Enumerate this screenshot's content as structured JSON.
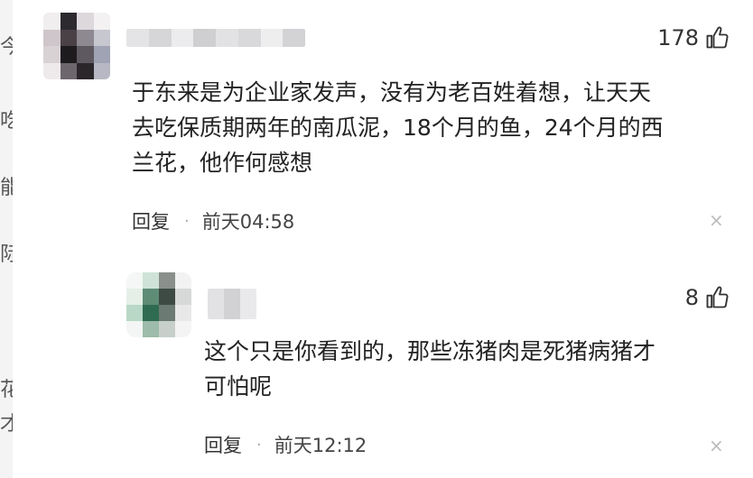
{
  "comment": {
    "likes": "178",
    "text_lines": [
      "于东来是为企业家发声，没有为老百姓着想，让天天",
      "去吃保质期两年的南瓜泥，18个月的鱼，24个月的西",
      "兰花，他作何感想"
    ],
    "reply_label": "回复",
    "separator": "·",
    "time": "前天04:58",
    "close_glyph": "×"
  },
  "reply": {
    "likes": "8",
    "text_lines": [
      "这个只是你看到的，那些冻猪肉是死猪病猪才",
      "可怕呢"
    ],
    "reply_label": "回复",
    "separator": "·",
    "time": "前天12:12",
    "close_glyph": "×"
  },
  "left_edge_glyphs": [
    "今",
    "吃",
    "能",
    "际",
    "花",
    "才"
  ],
  "colors": {
    "text": "#222222",
    "muted": "#444444",
    "close": "#bbbbbb"
  },
  "icons": {
    "like": "thumbs-up-icon",
    "close": "close-icon"
  }
}
